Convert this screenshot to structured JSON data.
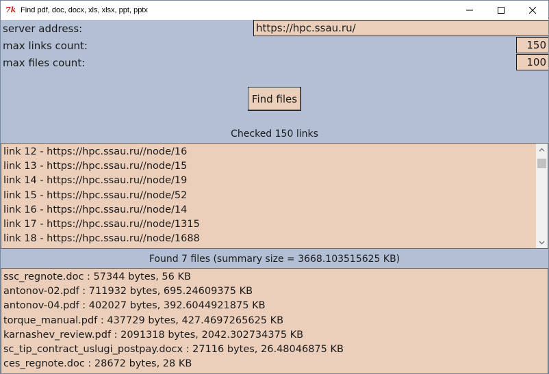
{
  "window": {
    "title": "Find pdf, doc, docx, xls, xlsx, ppt, pptx",
    "icon": "tk-feather-icon"
  },
  "form": {
    "server_label": "server address:",
    "server_value": "https://hpc.ssau.ru/",
    "max_links_label": "max links count:",
    "max_links_value": "150",
    "max_files_label": "max files count:",
    "max_files_value": "100"
  },
  "find_button": {
    "label": "Find files"
  },
  "links": {
    "status": "Checked 150 links",
    "items": [
      "link 12 - https://hpc.ssau.ru//node/16",
      "link 13 - https://hpc.ssau.ru//node/15",
      "link 14 - https://hpc.ssau.ru//node/19",
      "link 15 - https://hpc.ssau.ru//node/52",
      "link 16 - https://hpc.ssau.ru//node/14",
      "link 17 - https://hpc.ssau.ru//node/1315",
      "link 18 - https://hpc.ssau.ru//node/1688"
    ]
  },
  "files": {
    "status": "Found 7 files (summary size = 3668.103515625 KB)",
    "items": [
      "ssc_regnote.doc :  57344 bytes, 56 KB",
      "antonov-02.pdf :  711932 bytes, 695.24609375 KB",
      "antonov-04.pdf :  402027 bytes, 392.6044921875 KB",
      "torque_manual.pdf :  437729 bytes, 427.4697265625 KB",
      "karnashev_review.pdf :  2091318 bytes, 2042.302734375 KB",
      "sc_tip_contract_uslugi_postpay.docx :  27116 bytes, 26.48046875 KB",
      "ces_regnote.doc :  28672 bytes, 28 KB"
    ]
  },
  "colors": {
    "background": "#b2bfd4",
    "field": "#ebcfbb"
  }
}
